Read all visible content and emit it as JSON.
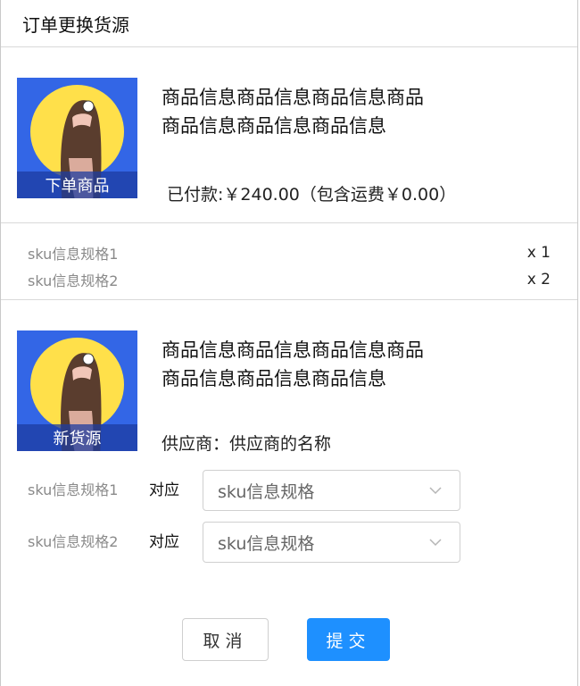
{
  "dialog": {
    "title": "订单更换货源"
  },
  "order_product": {
    "image_caption": "下单商品",
    "title_line1": "商品信息商品信息商品信息商品",
    "title_line2": "商品信息商品信息商品信息",
    "paid_text": "已付款:￥240.00（包含运费￥0.00）"
  },
  "sku_list": [
    {
      "spec": "sku信息规格1",
      "qty": "x 1"
    },
    {
      "spec": "sku信息规格2",
      "qty": "x 2"
    }
  ],
  "new_source": {
    "image_caption": "新货源",
    "title_line1": "商品信息商品信息商品信息商品",
    "title_line2": "商品信息商品信息商品信息",
    "supplier_text": "供应商：供应商的名称"
  },
  "mapping": [
    {
      "spec": "sku信息规格1",
      "corr": "对应",
      "select_value": "sku信息规格"
    },
    {
      "spec": "sku信息规格2",
      "corr": "对应",
      "select_value": "sku信息规格"
    }
  ],
  "footer": {
    "cancel_label": "取消",
    "submit_label": "提交"
  },
  "colors": {
    "primary": "#1e90ff",
    "image_bg": "#3366e6",
    "image_sun": "#ffe04a"
  }
}
